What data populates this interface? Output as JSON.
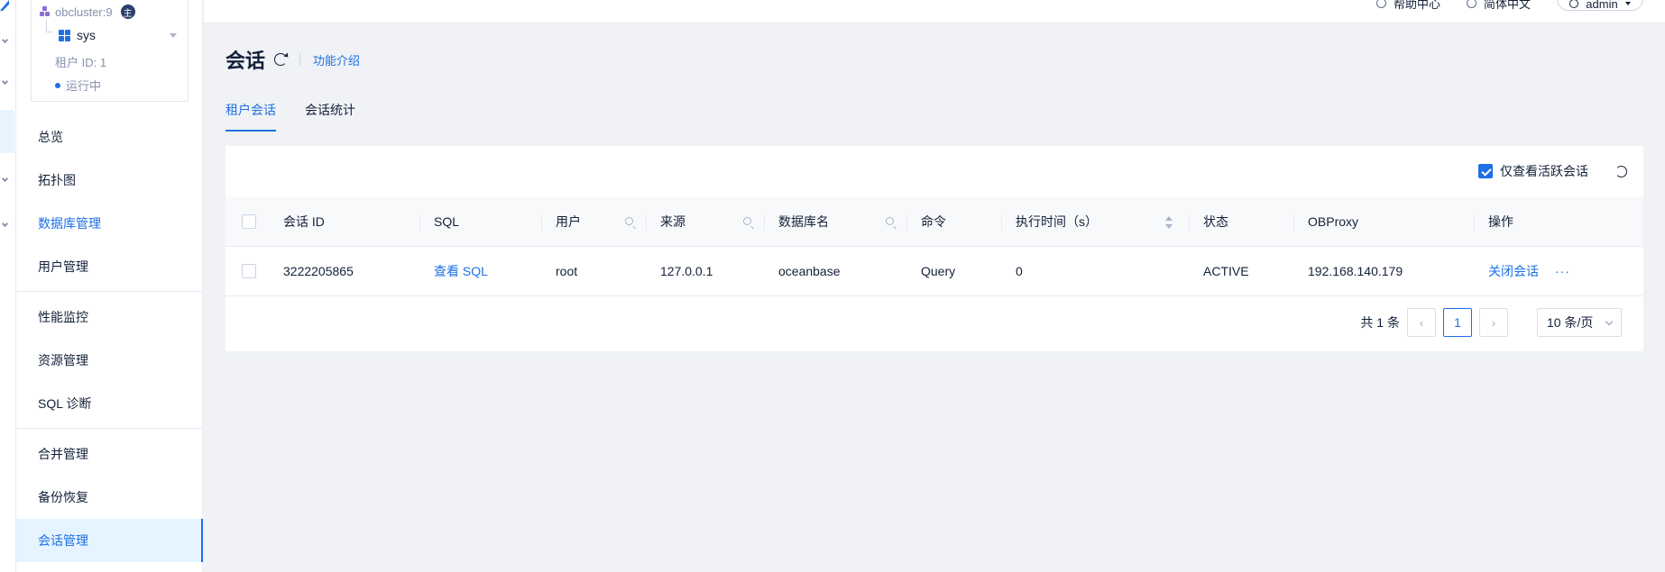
{
  "cluster": {
    "name": "obcluster:9",
    "badge": "主"
  },
  "tenant": {
    "name": "sys",
    "id_label": "租户 ID: 1",
    "status": "运行中"
  },
  "sidebar": {
    "items": [
      {
        "label": "总览"
      },
      {
        "label": "拓扑图"
      },
      {
        "label": "数据库管理"
      },
      {
        "label": "用户管理"
      },
      {
        "label": "性能监控"
      },
      {
        "label": "资源管理"
      },
      {
        "label": "SQL 诊断"
      },
      {
        "label": "合并管理"
      },
      {
        "label": "备份恢复"
      },
      {
        "label": "会话管理"
      }
    ]
  },
  "header": {
    "help": "帮助中心",
    "language": "简体中文",
    "user": "admin"
  },
  "page": {
    "title": "会话",
    "feature_link": "功能介绍"
  },
  "tabs": [
    {
      "label": "租户会话"
    },
    {
      "label": "会话统计"
    }
  ],
  "filter": {
    "active_only_label": "仅查看活跃会话",
    "checked": true
  },
  "table": {
    "columns": [
      "会话 ID",
      "SQL",
      "用户",
      "来源",
      "数据库名",
      "命令",
      "执行时间（s）",
      "状态",
      "OBProxy",
      "操作"
    ],
    "rows": [
      {
        "session_id": "3222205865",
        "sql": "查看 SQL",
        "user": "root",
        "source": "127.0.0.1",
        "database": "oceanbase",
        "command": "Query",
        "exec_time": "0",
        "status": "ACTIVE",
        "obproxy": "192.168.140.179",
        "action": "关闭会话",
        "more": "···"
      }
    ]
  },
  "pagination": {
    "total": "共 1 条",
    "current_page": "1",
    "page_size": "10 条/页"
  },
  "colors": {
    "primary": "#1f6fe5",
    "text": "#132039",
    "muted": "#8592ad",
    "bg": "#f0f2f5"
  }
}
